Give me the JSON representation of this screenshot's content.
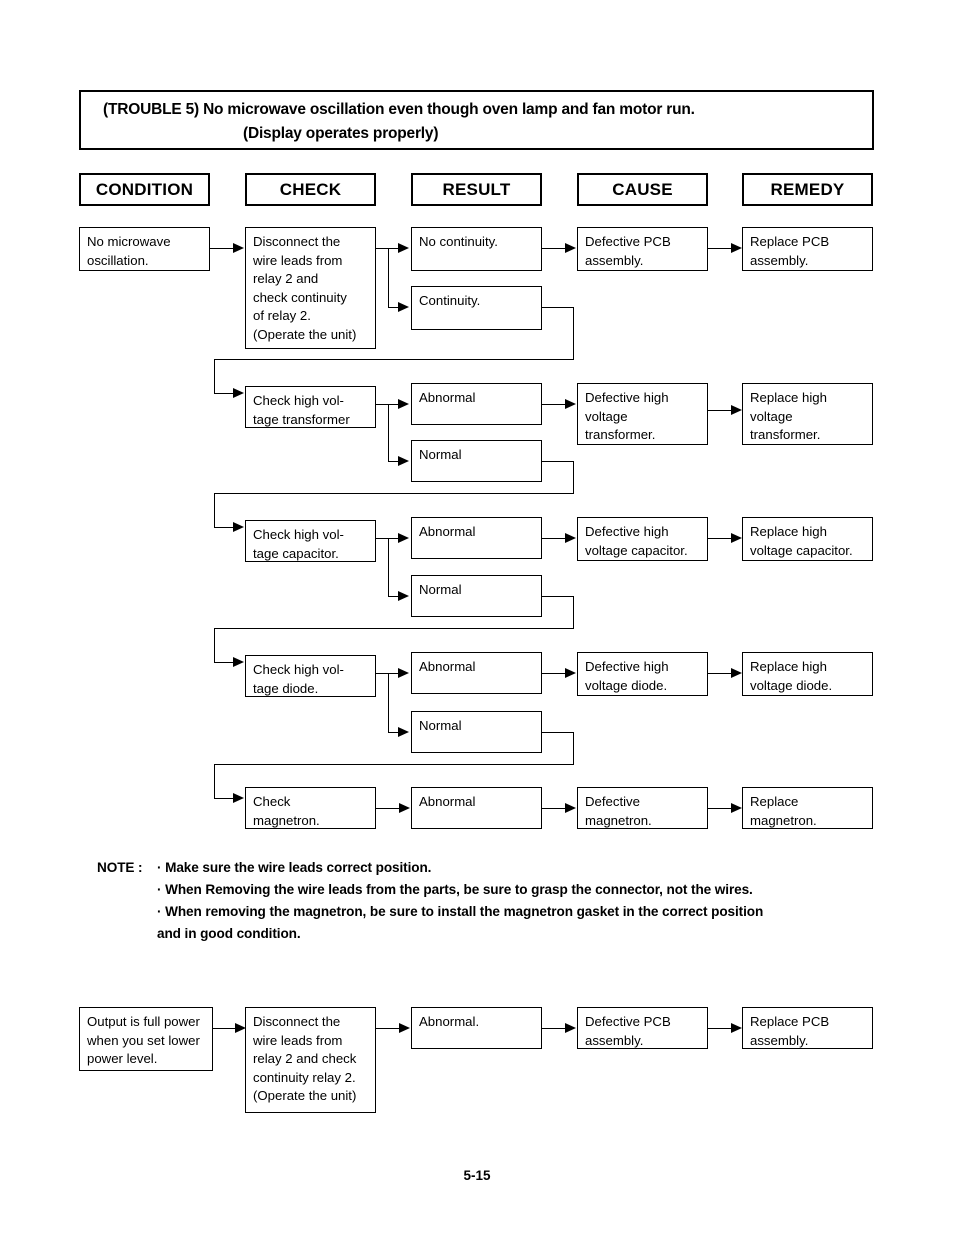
{
  "title": {
    "line1": "(TROUBLE 5) No microwave oscillation even though oven lamp and fan motor run.",
    "line2": "(Display operates properly)"
  },
  "columns": [
    {
      "label": "CONDITION"
    },
    {
      "label": "CHECK"
    },
    {
      "label": "RESULT"
    },
    {
      "label": "CAUSE"
    },
    {
      "label": "REMEDY"
    }
  ],
  "flow": {
    "condition": "No microwave\noscillation.",
    "rows": [
      {
        "check": "Disconnect the\nwire leads from\nrelay 2 and\ncheck continuity\nof relay 2.\n(Operate the unit)",
        "result_fail": "No continuity.",
        "result_pass": "Continuity.",
        "cause": "Defective PCB\nassembly.",
        "remedy": "Replace PCB\nassembly."
      },
      {
        "check": "Check high vol-\ntage transformer",
        "result_fail": "Abnormal",
        "result_pass": "Normal",
        "cause": "Defective high\nvoltage\ntransformer.",
        "remedy": "Replace high\nvoltage\ntransformer."
      },
      {
        "check": "Check high vol-\ntage capacitor.",
        "result_fail": "Abnormal",
        "result_pass": "Normal",
        "cause": "Defective high\nvoltage capacitor.",
        "remedy": "Replace high\nvoltage capacitor."
      },
      {
        "check": "Check high vol-\ntage diode.",
        "result_fail": "Abnormal",
        "result_pass": "Normal",
        "cause": "Defective high\nvoltage diode.",
        "remedy": "Replace high\nvoltage diode."
      },
      {
        "check": "Check\nmagnetron.",
        "result_fail": "Abnormal",
        "result_pass": null,
        "cause": "Defective\nmagnetron.",
        "remedy": "Replace\nmagnetron."
      }
    ]
  },
  "note": {
    "label": "NOTE :",
    "lines": [
      "· Make sure the wire leads correct position.",
      "· When Removing the wire leads from the parts, be sure to grasp the connector, not the wires.",
      "· When removing the magnetron, be sure to install the magnetron gasket in the correct position",
      "  and in good condition."
    ]
  },
  "second_flow": {
    "condition": "Output is full power\nwhen you set lower\npower level.",
    "check": "Disconnect the\nwire leads from\nrelay 2 and check\ncontinuity relay 2.\n(Operate the unit)",
    "result": "Abnormal.",
    "cause": "Defective PCB\nassembly.",
    "remedy": "Replace PCB\nassembly."
  },
  "footer": {
    "page_number": "5-15"
  }
}
